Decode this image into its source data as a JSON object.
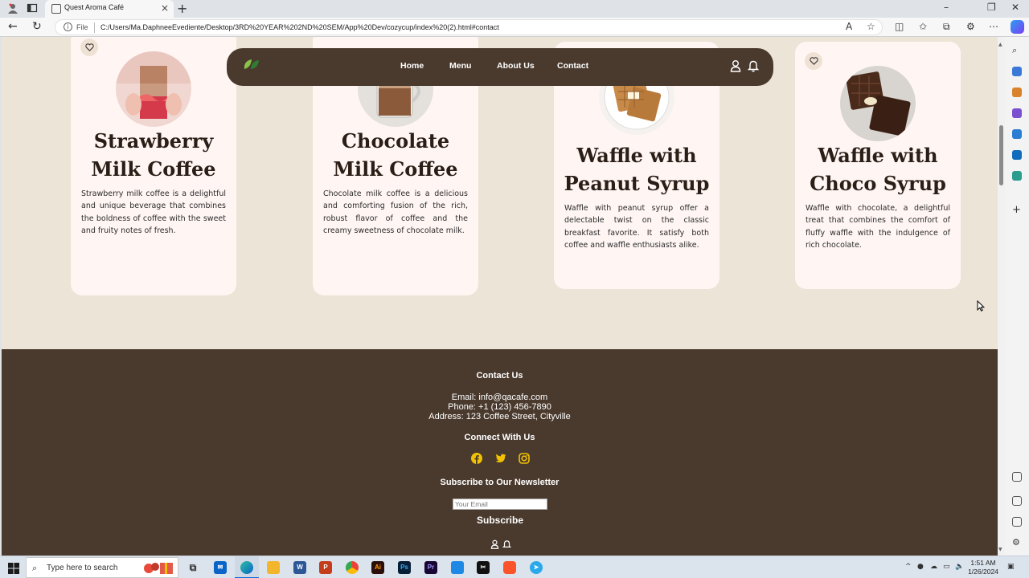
{
  "browser": {
    "tab_title": "Quest Aroma Café",
    "url_prefix": "File",
    "url": "C:/Users/Ma.DaphneeEvediente/Desktop/3RD%20YEAR%202ND%20SEM/App%20Dev/cozycup/index%20(2).html#contact"
  },
  "navbar": {
    "links": [
      "Home",
      "Menu",
      "About Us",
      "Contact"
    ]
  },
  "cards": [
    {
      "title_line1": "Strawberry",
      "title_line2": "Milk Coffee",
      "description": "Strawberry milk coffee is a delightful and unique beverage that combines the boldness of coffee with the sweet and fruity notes of fresh."
    },
    {
      "title_line1": "Chocolate",
      "title_line2": "Milk Coffee",
      "description": "Chocolate milk coffee is a delicious and comforting fusion of the rich, robust flavor of coffee and the creamy sweetness of chocolate milk."
    },
    {
      "title_line1": "Waffle with",
      "title_line2": "Peanut Syrup",
      "description": "Waffle with peanut syrup offer a delectable twist on the classic breakfast favorite. It satisfy both coffee and waffle enthusiasts alike."
    },
    {
      "title_line1": "Waffle with",
      "title_line2": "Choco Syrup",
      "description": "Waffle with chocolate, a delightful treat that combines the comfort of fluffy waffle with the indulgence of rich chocolate."
    }
  ],
  "footer": {
    "contact_heading": "Contact Us",
    "email": "Email: info@qacafe.com",
    "phone": "Phone: +1 (123) 456-7890",
    "address": "Address: 123 Coffee Street, Cityville",
    "connect_heading": "Connect With Us",
    "social_icons": [
      "facebook-icon",
      "twitter-icon",
      "instagram-icon"
    ],
    "newsletter_heading": "Subscribe to Our Newsletter",
    "email_placeholder": "Your Email",
    "subscribe_label": "Subscribe"
  },
  "taskbar": {
    "search_placeholder": "Type here to search",
    "time": "1:51 AM",
    "date": "1/26/2024"
  },
  "colors": {
    "page_bg": "#ece4d6",
    "brown": "#4a3a2e",
    "card_bg": "#fff6f4",
    "social_yellow": "#f2c200"
  }
}
